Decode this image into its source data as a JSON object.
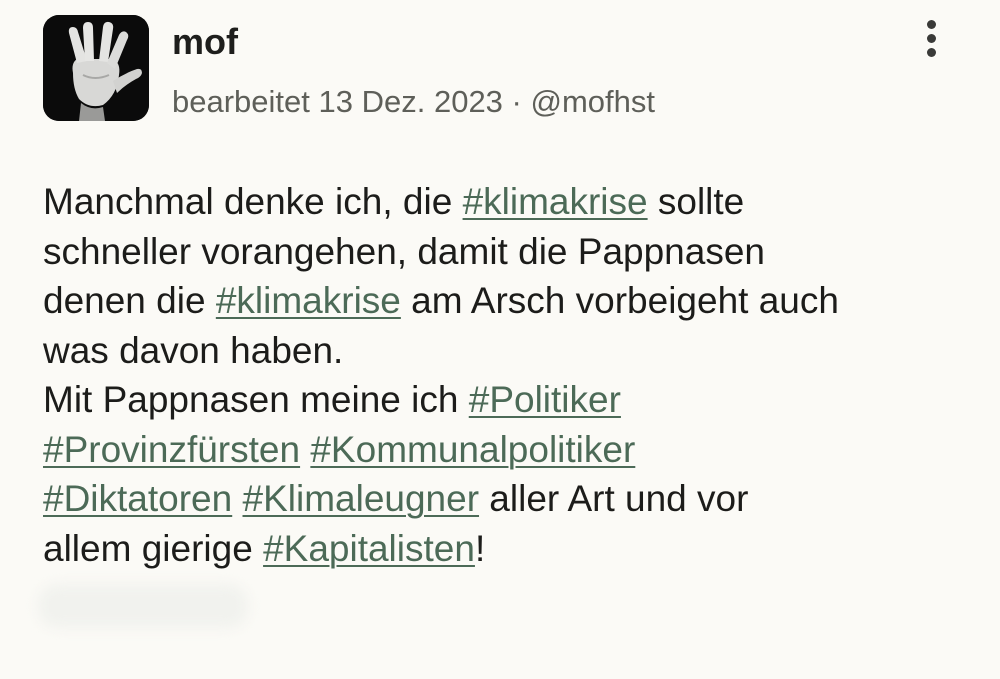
{
  "post": {
    "author": {
      "display_name": "mof",
      "avatar": "raised-hand-avatar"
    },
    "meta": {
      "edited_label": "bearbeitet",
      "date": "13 Dez. 2023",
      "separator": " · ",
      "handle": "@mofhst"
    },
    "menu_icon": "more-vertical-icon",
    "content": {
      "line1_before": "Manchmal denke ich, die ",
      "line1_tag": "#klimakrise",
      "line1_after": " sollte",
      "line2": "schneller vorangehen, damit die Pappnasen",
      "line3_before": "denen die ",
      "line3_tag": "#klimakrise",
      "line3_after": " am Arsch vorbeigeht auch",
      "line4": "was davon haben.",
      "line5_before": "Mit Pappnasen meine ich ",
      "line5_tag": "#Politiker",
      "line6_tag1": "#Provinzfürsten",
      "line6_tag2": "#Kommunalpolitiker",
      "line7_tag1": "#Diktatoren",
      "line7_tag2": "#Klimaleugner",
      "line7_after": " aller Art und vor",
      "line8_before": "allem gierige ",
      "line8_tag": "#Kapitalisten",
      "line8_after": "!"
    },
    "colors": {
      "background": "#fbfaf6",
      "text": "#1c1c1a",
      "meta": "#5e5f59",
      "hashtag": "#4c6a57"
    }
  }
}
